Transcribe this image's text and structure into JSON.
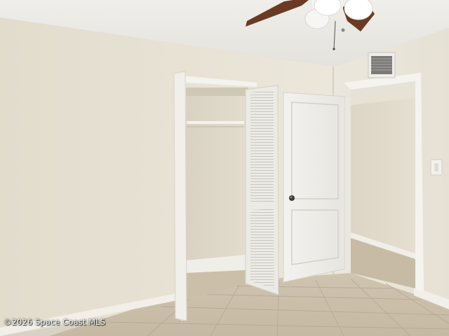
{
  "watermark": {
    "text": "©2026 Space Coast MLS"
  },
  "colors": {
    "wall": "#e8e3d6",
    "ceiling": "#ecebe6",
    "trim": "#f2f0ea",
    "floor_tile": "#c9bda8",
    "grout": "#b3a892",
    "fan_blade": "#6b3a22"
  },
  "icons": [
    "ceiling-fan-icon",
    "air-vent-icon",
    "light-switch-icon",
    "door-knob-icon"
  ]
}
